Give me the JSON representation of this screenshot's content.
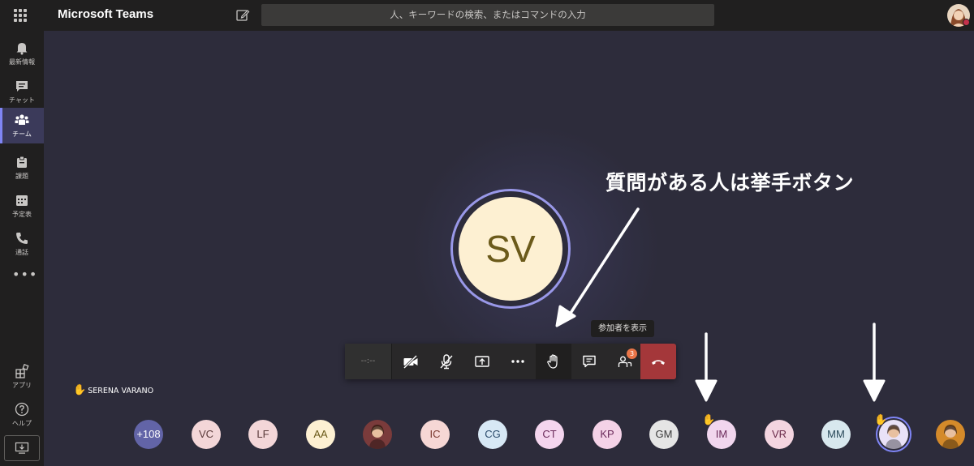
{
  "app": {
    "title": "Microsoft Teams"
  },
  "search": {
    "placeholder": "人、キーワードの検索、またはコマンドの入力"
  },
  "rail": {
    "items": [
      {
        "label": "最新情報",
        "icon": "bell-icon"
      },
      {
        "label": "チャット",
        "icon": "chat-icon"
      },
      {
        "label": "チーム",
        "icon": "teams-icon"
      },
      {
        "label": "課題",
        "icon": "assignments-icon"
      },
      {
        "label": "予定表",
        "icon": "calendar-icon"
      },
      {
        "label": "通話",
        "icon": "phone-icon"
      }
    ],
    "more": "•••",
    "bottom": [
      {
        "label": "アプリ",
        "icon": "apps-icon"
      },
      {
        "label": "ヘルプ",
        "icon": "help-icon"
      }
    ]
  },
  "call": {
    "main_initials": "SV",
    "annotation": "質問がある人は挙手ボタン",
    "tooltip": "参加者を表示",
    "timer": "--:--",
    "participants_badge": "3",
    "speaker_name": "SERENA VARANO"
  },
  "participants": [
    {
      "label": "+108",
      "bg": "#6264a7",
      "fg": "#ffffff"
    },
    {
      "label": "VC",
      "bg": "#f3d6d8",
      "fg": "#5a3a3a"
    },
    {
      "label": "LF",
      "bg": "#f3d6d8",
      "fg": "#5a3a3a"
    },
    {
      "label": "AA",
      "bg": "#fdf0d2",
      "fg": "#6b5a1a"
    },
    {
      "label": "",
      "bg": "#7a3b3b",
      "fg": "#ffffff",
      "photo": true
    },
    {
      "label": "IC",
      "bg": "#f6d7d5",
      "fg": "#7a3a30"
    },
    {
      "label": "CG",
      "bg": "#d7e8f5",
      "fg": "#2a4a6a"
    },
    {
      "label": "CT",
      "bg": "#f4d5ee",
      "fg": "#6a2a5a"
    },
    {
      "label": "KP",
      "bg": "#f4d2e7",
      "fg": "#6a2a5a"
    },
    {
      "label": "GM",
      "bg": "#e5e5e5",
      "fg": "#3a3a3a"
    },
    {
      "label": "IM",
      "bg": "#f1d6ee",
      "fg": "#6a2a5a",
      "raised": true
    },
    {
      "label": "VR",
      "bg": "#f4d5e0",
      "fg": "#6a2a4a"
    },
    {
      "label": "MM",
      "bg": "#d8e8ee",
      "fg": "#2a4a5a"
    },
    {
      "label": "",
      "bg": "#e9e2f7",
      "fg": "#ffffff",
      "photo": true,
      "raised": true,
      "ring": true
    },
    {
      "label": "",
      "bg": "#d48a2a",
      "fg": "#ffffff",
      "photo": true
    }
  ],
  "colors": {
    "accent": "#7f85f5",
    "hangup": "#a4373a",
    "badge": "#e97548"
  }
}
